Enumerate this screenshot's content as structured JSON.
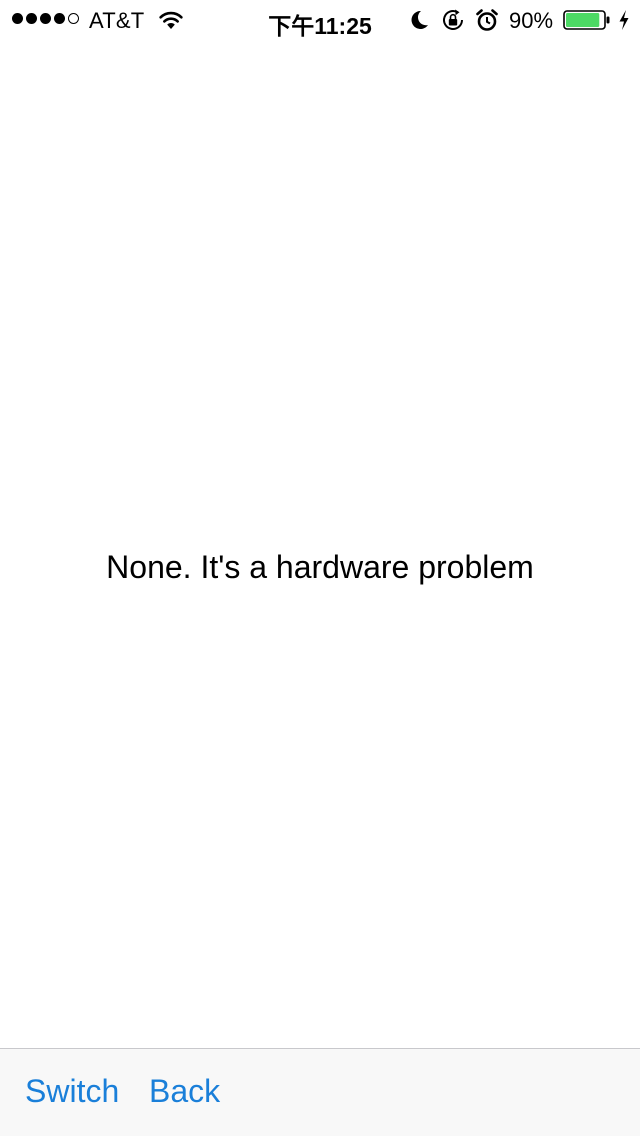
{
  "status_bar": {
    "carrier": "AT&T",
    "time": "下午11:25",
    "battery_percent": "90%",
    "battery_level": 0.9,
    "battery_color": "#4cd964",
    "signal_bars_filled": 4,
    "signal_bars_total": 5,
    "icons": [
      "wifi-icon",
      "moon-icon",
      "rotation-lock-icon",
      "alarm-icon",
      "battery-icon",
      "charging-bolt-icon"
    ]
  },
  "main": {
    "message": "None. It's a hardware problem"
  },
  "toolbar": {
    "switch_label": "Switch",
    "back_label": "Back",
    "tint_color": "#1a7fd9"
  }
}
